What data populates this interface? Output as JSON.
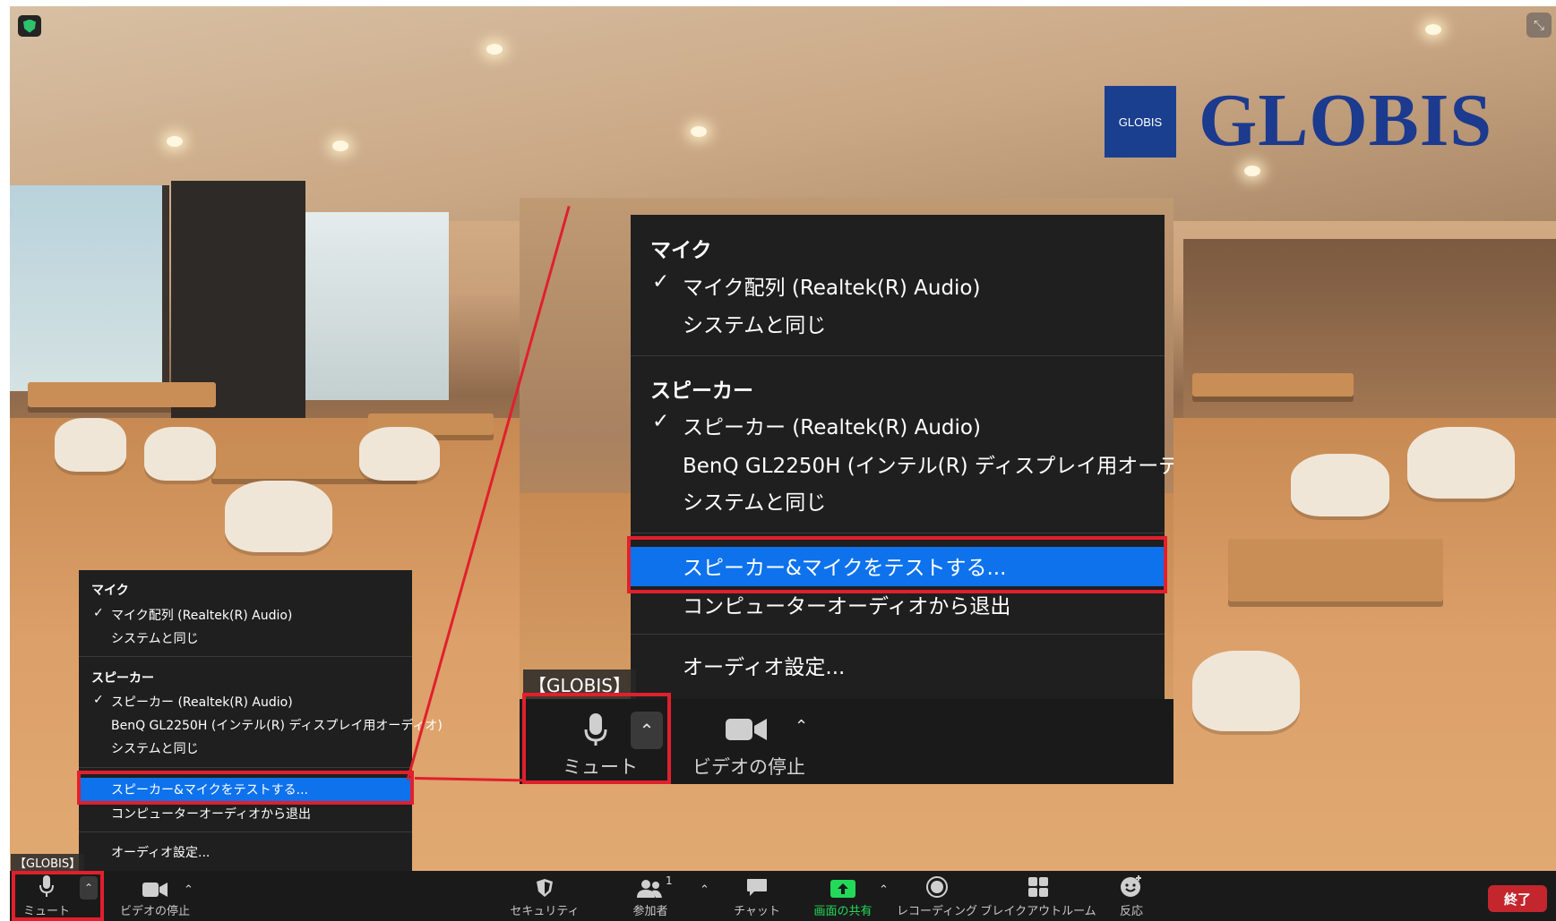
{
  "meeting": {
    "logo_badge": "GLOBIS",
    "logo_text": "GLOBIS",
    "name_tag": "【GLOBIS】"
  },
  "audio_menu": {
    "mic_header": "マイク",
    "mic_devices": [
      "マイク配列 (Realtek(R) Audio)",
      "システムと同じ"
    ],
    "speaker_header": "スピーカー",
    "speaker_devices": [
      "スピーカー (Realtek(R) Audio)",
      "BenQ GL2250H (インテル(R) ディスプレイ用オーディオ)",
      "システムと同じ"
    ],
    "test_label": "スピーカー&マイクをテストする...",
    "leave_label": "コンピューターオーディオから退出",
    "settings_label": "オーディオ設定...",
    "checkmark": "✓"
  },
  "toolbar": {
    "mute_label": "ミュート",
    "video_label": "ビデオの停止",
    "security_label": "セキュリティ",
    "participants_label": "参加者",
    "participants_count": "1",
    "chat_label": "チャット",
    "share_label": "画面の共有",
    "record_label": "レコーディング",
    "breakout_label": "ブレイクアウトルーム",
    "reactions_label": "反応",
    "end_label": "終了",
    "caret": "⌃"
  },
  "colors": {
    "highlight": "#0e72ed",
    "callout": "#e0202d",
    "share_green": "#23d959",
    "end_red": "#c4262e"
  }
}
